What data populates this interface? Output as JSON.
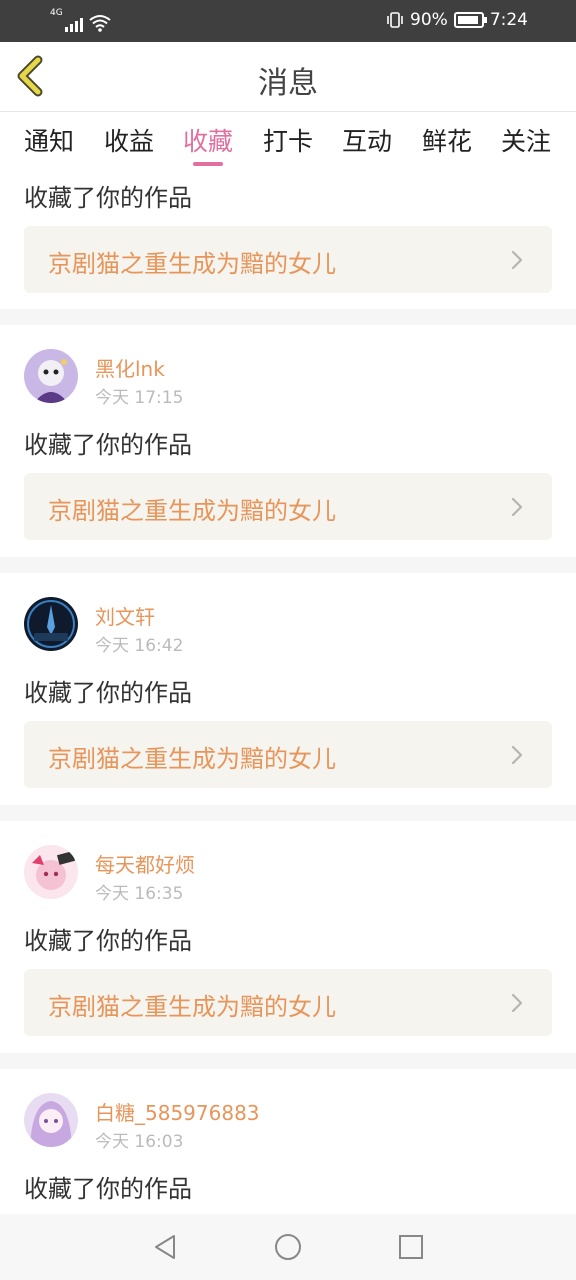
{
  "status_bar": {
    "network": "4G",
    "battery_percent": "90%",
    "time": "7:24"
  },
  "header": {
    "title": "消息",
    "back_icon": "chevron-left-icon"
  },
  "tabs": [
    {
      "label": "通知",
      "active": false
    },
    {
      "label": "收益",
      "active": false
    },
    {
      "label": "收藏",
      "active": true
    },
    {
      "label": "打卡",
      "active": false
    },
    {
      "label": "互动",
      "active": false
    },
    {
      "label": "鲜花",
      "active": false
    },
    {
      "label": "关注",
      "active": false
    }
  ],
  "first_item": {
    "action": "收藏了你的作品",
    "work_title": "京剧猫之重生成为黯的女儿"
  },
  "items": [
    {
      "username": "黑化lnk",
      "time": "今天 17:15",
      "action": "收藏了你的作品",
      "work_title": "京剧猫之重生成为黯的女儿"
    },
    {
      "username": "刘文轩",
      "time": "今天 16:42",
      "action": "收藏了你的作品",
      "work_title": "京剧猫之重生成为黯的女儿"
    },
    {
      "username": "每天都好烦",
      "time": "今天 16:35",
      "action": "收藏了你的作品",
      "work_title": "京剧猫之重生成为黯的女儿"
    },
    {
      "username": "白糖_585976883",
      "time": "今天 16:03",
      "action": "收藏了你的作品"
    }
  ],
  "colors": {
    "accent_pink": "#e070a0",
    "username_orange": "#e8955a",
    "work_box_bg": "#f5f4ef",
    "status_bar_bg": "#3f3f3f"
  }
}
